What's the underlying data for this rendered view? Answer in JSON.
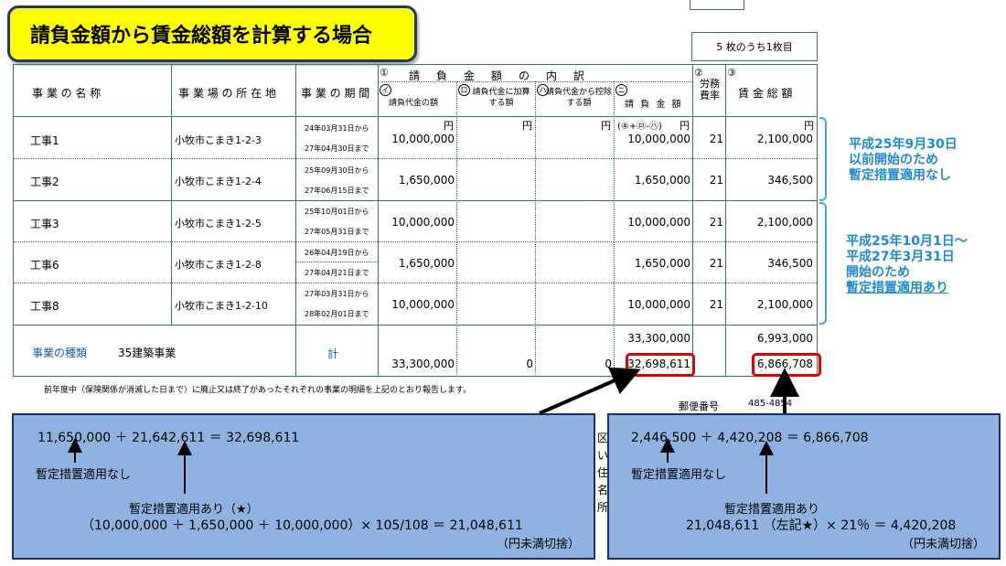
{
  "title": "請負金額から賃金総額を計算する場合",
  "page_count": "5 枚のうち1枚目",
  "header": {
    "jigyou_meisho": "事 業 の 名 称",
    "shozaichi": "事 業 場 の 所 在 地",
    "kikan": "事 業 の 期 間",
    "ukeoi_uchiwake": "請　負　金　額　の　内　訳",
    "ukeoi_dai": "請負代金の額",
    "kasan": "請負代金に加算する額",
    "kouyo": "請負代金から控除する額",
    "ukeoi_kingaku": "請 負 金 額",
    "formula": "(④+㋺-㋩)",
    "roumu": "労務費率",
    "chingin": "賃 金 総 額",
    "mark1": "①",
    "mark2": "②",
    "mark3": "③",
    "mark_i": "イ",
    "mark_ro": "ロ",
    "mark_ha": "ハ",
    "mark_ni": "ニ"
  },
  "yen": "円",
  "rows": [
    {
      "name": "工事1",
      "address": "小牧市こまき1-2-3",
      "from": "24年03月31日から",
      "to": "27年04月30日まで",
      "ukeoi": "10,000,000",
      "kingaku": "10,000,000",
      "rate": "21",
      "chingin": "2,100,000"
    },
    {
      "name": "工事2",
      "address": "小牧市こまき1-2-4",
      "from": "25年09月30日から",
      "to": "27年06月15日まで",
      "ukeoi": "1,650,000",
      "kingaku": "1,650,000",
      "rate": "21",
      "chingin": "346,500"
    },
    {
      "name": "工事3",
      "address": "小牧市こまき1-2-5",
      "from": "25年10月01日から",
      "to": "27年05月31日まで",
      "ukeoi": "10,000,000",
      "kingaku": "10,000,000",
      "rate": "21",
      "chingin": "2,100,000"
    },
    {
      "name": "工事6",
      "address": "小牧市こまき1-2-8",
      "from": "26年04月19日から",
      "to": "27年04月21日まで",
      "ukeoi": "1,650,000",
      "kingaku": "1,650,000",
      "rate": "21",
      "chingin": "346,500"
    },
    {
      "name": "工事8",
      "address": "小牧市こまき1-2-10",
      "from": "27年03月31日から",
      "to": "28年02月01日まで",
      "ukeoi": "10,000,000",
      "kingaku": "10,000,000",
      "rate": "21",
      "chingin": "2,100,000"
    }
  ],
  "total": {
    "shurui_label": "事業の種類",
    "shurui_value": "35建築事業",
    "kei": "計",
    "kingaku_top": "33,300,000",
    "chingin_top": "6,993,000",
    "ukeoi": "33,300,000",
    "kasan": "0",
    "kouyo": "0",
    "kingaku_bottom": "32,698,611",
    "chingin_bottom": "6,866,708"
  },
  "footnote": "前年度中（保険関係が消滅した日まで）に廃止又は終了があったそれぞれの事業の明細を上記のとおり報告します。",
  "postal_label": "郵便番号",
  "postal_value": "485-4854",
  "notes": {
    "group1": [
      "平成25年9月30日",
      "以前開始のため",
      "暫定措置適用なし"
    ],
    "group2": [
      "平成25年10月1日～",
      "平成27年3月31日",
      "開始のため",
      "暫定措置適用あり"
    ]
  },
  "panel_left": {
    "equation": "11,650,000 ＋ 21,642,611 ＝ 32,698,611",
    "label_none": "暫定措置適用なし",
    "label_applied": "暫定措置適用あり（★）",
    "calc": "（10,000,000 ＋ 1,650,000 ＋ 10,000,000）× 105/108 ＝ 21,048,611",
    "rounding": "（円未満切捨）"
  },
  "panel_right": {
    "equation": "2,446,500 ＋ 4,420,208 ＝ 6,866,708",
    "label_none": "暫定措置適用なし",
    "label_applied": "暫定措置適用あり",
    "calc": "21,048,611 （左記★）× 21％ ＝ 4,420,208",
    "rounding": "（円未満切捨）"
  },
  "peek_chars": [
    "区",
    "い",
    "住",
    "名",
    "所"
  ],
  "colors": {
    "title_bg": "#ffff00",
    "table_line": "#2e7d5a",
    "note": "#1f8ad0",
    "red": "#e00000",
    "panel": "#8fb3e0"
  }
}
